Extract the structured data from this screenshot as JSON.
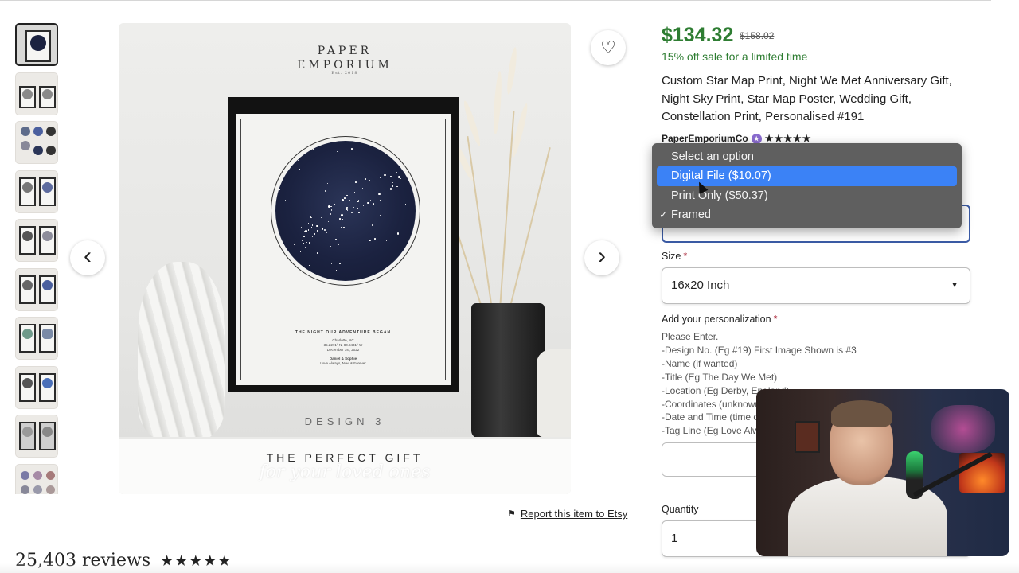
{
  "listing": {
    "price": "$134.32",
    "original_price": "$158.02",
    "sale_text": "15% off sale for a limited time",
    "title": "Custom Star Map Print, Night We Met Anniversary Gift, Night Sky Print, Star Map Poster, Wedding Gift, Constellation Print, Personalised #191",
    "shop_name": "PaperEmporiumCo",
    "shop_rating_stars": "★★★★★"
  },
  "image": {
    "brand_line1": "PAPER",
    "brand_line2": "EMPORIUM",
    "brand_sub": "Est. 2018",
    "print_title": "THE NIGHT OUR ADVENTURE BEGAN",
    "print_line1": "Charlotte, NC",
    "print_line2": "35.2271° N, 80.8431° W",
    "print_line3": "December 1st, 2022",
    "print_names": "Daniel & Sophie",
    "print_tag": "Love Always, Now & Forever",
    "design_label": "DESIGN 3",
    "gift_line1": "THE PERFECT GIFT",
    "gift_line2": "for your loved ones"
  },
  "gallery": {
    "prev_icon": "‹",
    "next_icon": "›",
    "favorite_icon": "♡",
    "thumbnail_count": 10
  },
  "style_dropdown": {
    "options": [
      "Select an option",
      "Digital File ($10.07)",
      "Print Only ($50.37)",
      "Framed"
    ],
    "highlighted_index": 1,
    "checked_index": 3
  },
  "size": {
    "label": "Size",
    "required_mark": "*",
    "value": "16x20 Inch"
  },
  "personalization": {
    "label": "Add your personalization",
    "required_mark": "*",
    "lines": [
      "Please Enter.",
      "-Design No. (Eg #19) First Image Shown is #3",
      "-Name (if wanted)",
      "-Title (Eg The Day We Met)",
      "-Location (Eg Derby, England)",
      "-Coordinates (unknown if not entered)",
      "-Date and Time (time optional)",
      "-Tag Line (Eg Love Always)"
    ]
  },
  "quantity": {
    "label": "Quantity",
    "value": "1"
  },
  "report_link": "Report this item to Etsy",
  "reviews": {
    "count_text": "25,403 reviews",
    "stars": "★★★★★"
  },
  "colors": {
    "price_green": "#2e7d32",
    "highlight_blue": "#3b82f6",
    "required_red": "#a61a2e"
  }
}
